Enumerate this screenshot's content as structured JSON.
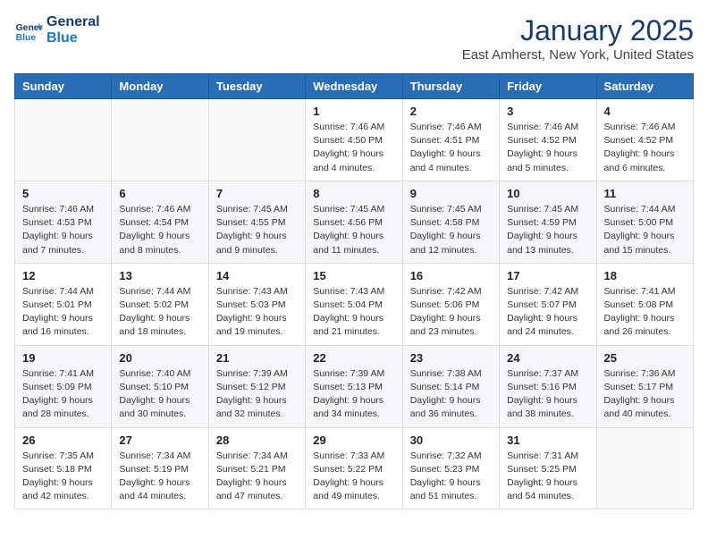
{
  "header": {
    "logo_line1": "General",
    "logo_line2": "Blue",
    "month": "January 2025",
    "location": "East Amherst, New York, United States"
  },
  "weekdays": [
    "Sunday",
    "Monday",
    "Tuesday",
    "Wednesday",
    "Thursday",
    "Friday",
    "Saturday"
  ],
  "weeks": [
    [
      {
        "day": "",
        "info": ""
      },
      {
        "day": "",
        "info": ""
      },
      {
        "day": "",
        "info": ""
      },
      {
        "day": "1",
        "info": "Sunrise: 7:46 AM\nSunset: 4:50 PM\nDaylight: 9 hours and 4 minutes."
      },
      {
        "day": "2",
        "info": "Sunrise: 7:46 AM\nSunset: 4:51 PM\nDaylight: 9 hours and 4 minutes."
      },
      {
        "day": "3",
        "info": "Sunrise: 7:46 AM\nSunset: 4:52 PM\nDaylight: 9 hours and 5 minutes."
      },
      {
        "day": "4",
        "info": "Sunrise: 7:46 AM\nSunset: 4:52 PM\nDaylight: 9 hours and 6 minutes."
      }
    ],
    [
      {
        "day": "5",
        "info": "Sunrise: 7:46 AM\nSunset: 4:53 PM\nDaylight: 9 hours and 7 minutes."
      },
      {
        "day": "6",
        "info": "Sunrise: 7:46 AM\nSunset: 4:54 PM\nDaylight: 9 hours and 8 minutes."
      },
      {
        "day": "7",
        "info": "Sunrise: 7:45 AM\nSunset: 4:55 PM\nDaylight: 9 hours and 9 minutes."
      },
      {
        "day": "8",
        "info": "Sunrise: 7:45 AM\nSunset: 4:56 PM\nDaylight: 9 hours and 11 minutes."
      },
      {
        "day": "9",
        "info": "Sunrise: 7:45 AM\nSunset: 4:58 PM\nDaylight: 9 hours and 12 minutes."
      },
      {
        "day": "10",
        "info": "Sunrise: 7:45 AM\nSunset: 4:59 PM\nDaylight: 9 hours and 13 minutes."
      },
      {
        "day": "11",
        "info": "Sunrise: 7:44 AM\nSunset: 5:00 PM\nDaylight: 9 hours and 15 minutes."
      }
    ],
    [
      {
        "day": "12",
        "info": "Sunrise: 7:44 AM\nSunset: 5:01 PM\nDaylight: 9 hours and 16 minutes."
      },
      {
        "day": "13",
        "info": "Sunrise: 7:44 AM\nSunset: 5:02 PM\nDaylight: 9 hours and 18 minutes."
      },
      {
        "day": "14",
        "info": "Sunrise: 7:43 AM\nSunset: 5:03 PM\nDaylight: 9 hours and 19 minutes."
      },
      {
        "day": "15",
        "info": "Sunrise: 7:43 AM\nSunset: 5:04 PM\nDaylight: 9 hours and 21 minutes."
      },
      {
        "day": "16",
        "info": "Sunrise: 7:42 AM\nSunset: 5:06 PM\nDaylight: 9 hours and 23 minutes."
      },
      {
        "day": "17",
        "info": "Sunrise: 7:42 AM\nSunset: 5:07 PM\nDaylight: 9 hours and 24 minutes."
      },
      {
        "day": "18",
        "info": "Sunrise: 7:41 AM\nSunset: 5:08 PM\nDaylight: 9 hours and 26 minutes."
      }
    ],
    [
      {
        "day": "19",
        "info": "Sunrise: 7:41 AM\nSunset: 5:09 PM\nDaylight: 9 hours and 28 minutes."
      },
      {
        "day": "20",
        "info": "Sunrise: 7:40 AM\nSunset: 5:10 PM\nDaylight: 9 hours and 30 minutes."
      },
      {
        "day": "21",
        "info": "Sunrise: 7:39 AM\nSunset: 5:12 PM\nDaylight: 9 hours and 32 minutes."
      },
      {
        "day": "22",
        "info": "Sunrise: 7:39 AM\nSunset: 5:13 PM\nDaylight: 9 hours and 34 minutes."
      },
      {
        "day": "23",
        "info": "Sunrise: 7:38 AM\nSunset: 5:14 PM\nDaylight: 9 hours and 36 minutes."
      },
      {
        "day": "24",
        "info": "Sunrise: 7:37 AM\nSunset: 5:16 PM\nDaylight: 9 hours and 38 minutes."
      },
      {
        "day": "25",
        "info": "Sunrise: 7:36 AM\nSunset: 5:17 PM\nDaylight: 9 hours and 40 minutes."
      }
    ],
    [
      {
        "day": "26",
        "info": "Sunrise: 7:35 AM\nSunset: 5:18 PM\nDaylight: 9 hours and 42 minutes."
      },
      {
        "day": "27",
        "info": "Sunrise: 7:34 AM\nSunset: 5:19 PM\nDaylight: 9 hours and 44 minutes."
      },
      {
        "day": "28",
        "info": "Sunrise: 7:34 AM\nSunset: 5:21 PM\nDaylight: 9 hours and 47 minutes."
      },
      {
        "day": "29",
        "info": "Sunrise: 7:33 AM\nSunset: 5:22 PM\nDaylight: 9 hours and 49 minutes."
      },
      {
        "day": "30",
        "info": "Sunrise: 7:32 AM\nSunset: 5:23 PM\nDaylight: 9 hours and 51 minutes."
      },
      {
        "day": "31",
        "info": "Sunrise: 7:31 AM\nSunset: 5:25 PM\nDaylight: 9 hours and 54 minutes."
      },
      {
        "day": "",
        "info": ""
      }
    ]
  ]
}
